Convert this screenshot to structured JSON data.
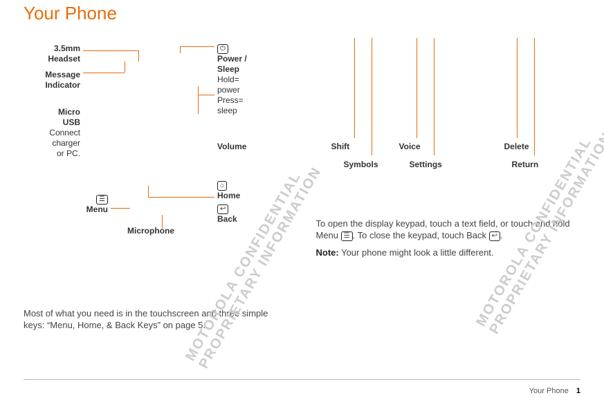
{
  "title": "Your Phone",
  "left": {
    "callouts": {
      "headset": "3.5mm\nHeadset",
      "msgInd": "Message\nIndicator",
      "microUsbBold": "Micro\nUSB",
      "microUsbSub": "Connect\ncharger\nor PC.",
      "menu": "Menu",
      "powerBold": "Power /\nSleep",
      "powerSub": "Hold=\npower\nPress=\nsleep",
      "volume": "Volume",
      "home": "Home",
      "back": "Back",
      "microphone": "Microphone"
    },
    "body": "Most of what you need is in the touchscreen and three simple keys: “Menu, Home, & Back Keys” on page 5."
  },
  "right": {
    "labels": {
      "shift": "Shift",
      "symbols": "Symbols",
      "voice": "Voice",
      "settings": "Settings",
      "delete": "Delete",
      "return": "Return"
    },
    "body1a": "To open the display keypad, touch a text field, or touch and hold Menu ",
    "body1b": ". To close the keypad, touch Back ",
    "body1c": ".",
    "noteLabel": "Note:",
    "noteBody": " Your phone might look a little different."
  },
  "icons": {
    "power": "⏻",
    "menu": "☰",
    "home": "⌂",
    "back": "↩"
  },
  "watermark": "MOTOROLA CONFIDENTIAL\nPROPRIETARY INFORMATION",
  "footer": {
    "section": "Your Phone",
    "page": "1"
  }
}
